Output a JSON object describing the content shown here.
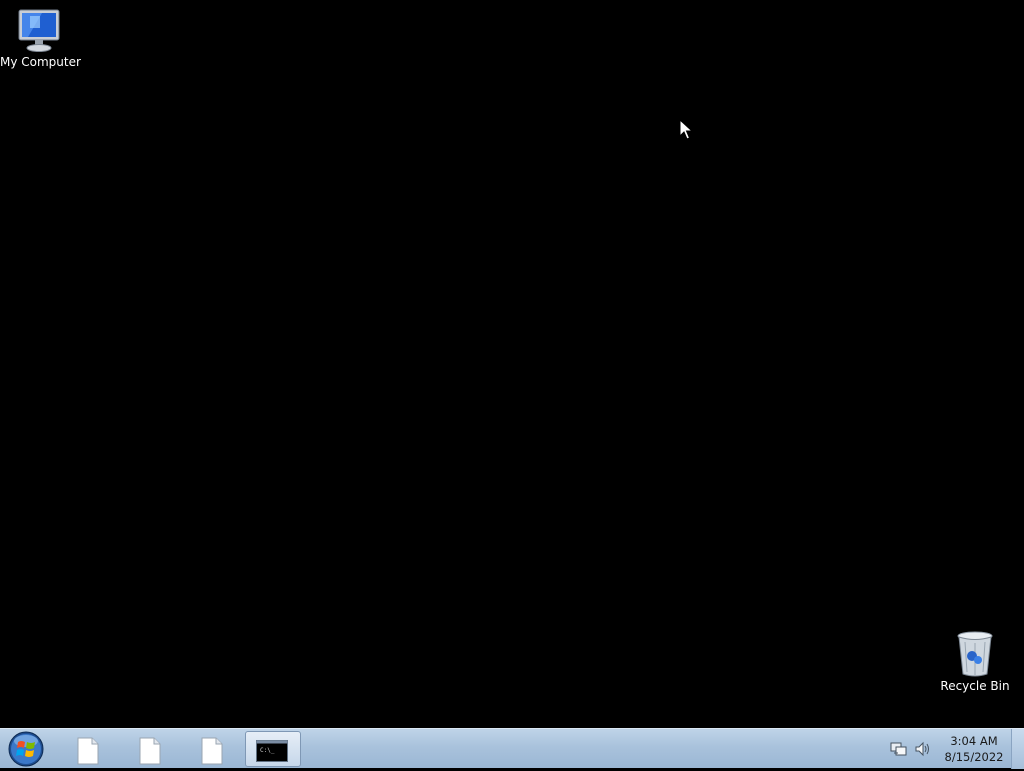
{
  "desktop": {
    "icons": [
      {
        "label": "My Computer",
        "icon": "computer-icon"
      },
      {
        "label": "Recycle Bin",
        "icon": "recycle-bin-icon"
      }
    ]
  },
  "taskbar": {
    "start_icon": "windows-orb-icon",
    "buttons": [
      {
        "icon": "document-icon",
        "active": false
      },
      {
        "icon": "document-icon",
        "active": false
      },
      {
        "icon": "document-icon",
        "active": false
      },
      {
        "icon": "command-prompt-icon",
        "active": true,
        "glyph_text": "C:\\_"
      }
    ],
    "tray": {
      "icons": [
        "network-icon",
        "volume-icon"
      ],
      "time": "3:04 AM",
      "date": "8/15/2022"
    }
  },
  "colors": {
    "desktop_background": "#000000",
    "taskbar": "#a9c2dc"
  }
}
